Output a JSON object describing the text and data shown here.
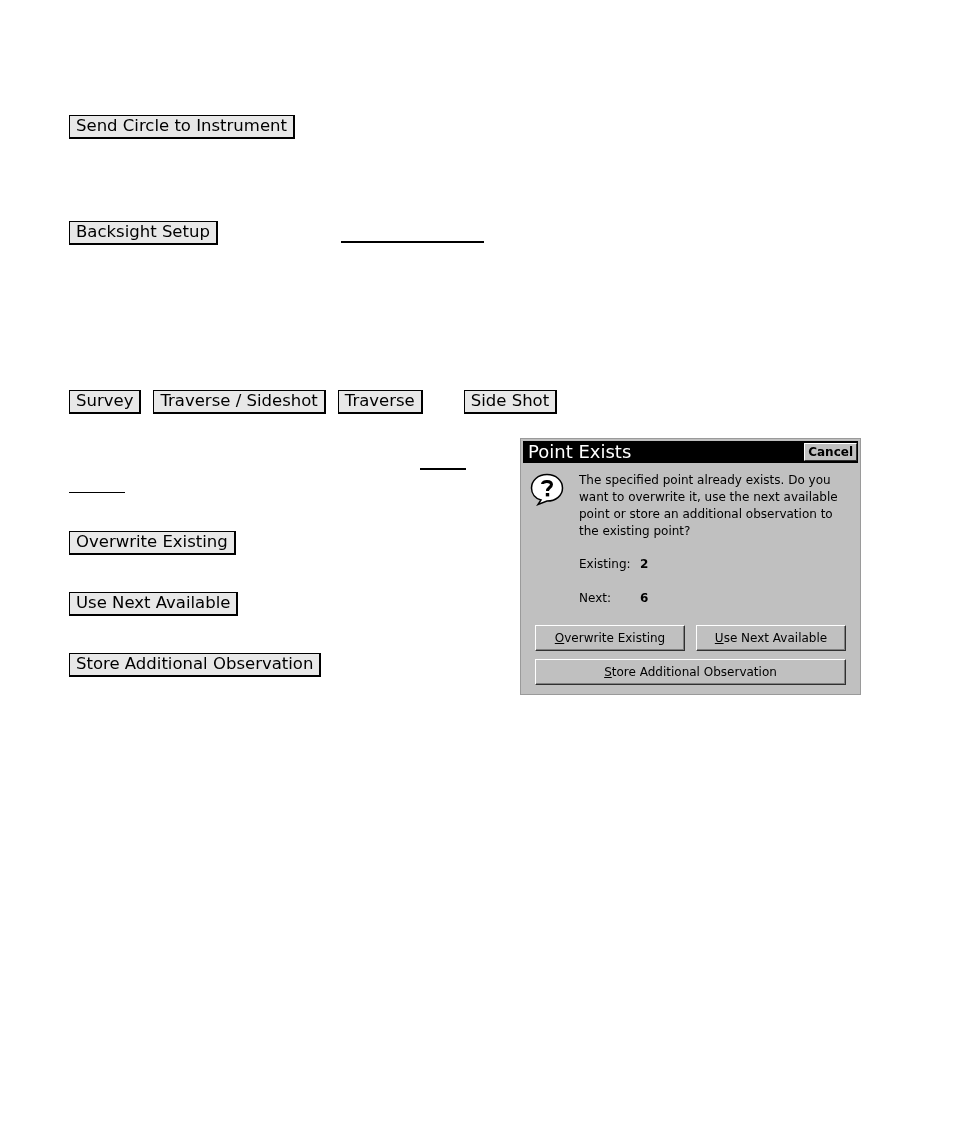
{
  "document": {
    "send_circle_button": "Send Circle to Instrument",
    "backsight_button": "Backsight Setup",
    "menu_path": [
      "Survey",
      "Traverse / Sideshot",
      "Traverse",
      "Side Shot"
    ],
    "option_buttons": [
      "Overwrite Existing",
      "Use Next Available",
      "Store Additional Observation"
    ]
  },
  "dialog": {
    "title": "Point Exists",
    "close_button": "Cancel",
    "message": "The specified point already exists. Do you want to overwrite it, use the next available point or store an additional observation to the existing point?",
    "fields": [
      {
        "label": "Existing:",
        "value": "2"
      },
      {
        "label": "Next:",
        "value": "6"
      }
    ],
    "buttons": [
      {
        "label": "Overwrite Existing",
        "mnemonic_underlined": true
      },
      {
        "label": "Use Next Available",
        "mnemonic_underlined": true
      },
      {
        "label": "Store Additional Observation",
        "mnemonic_underlined": true
      }
    ]
  }
}
